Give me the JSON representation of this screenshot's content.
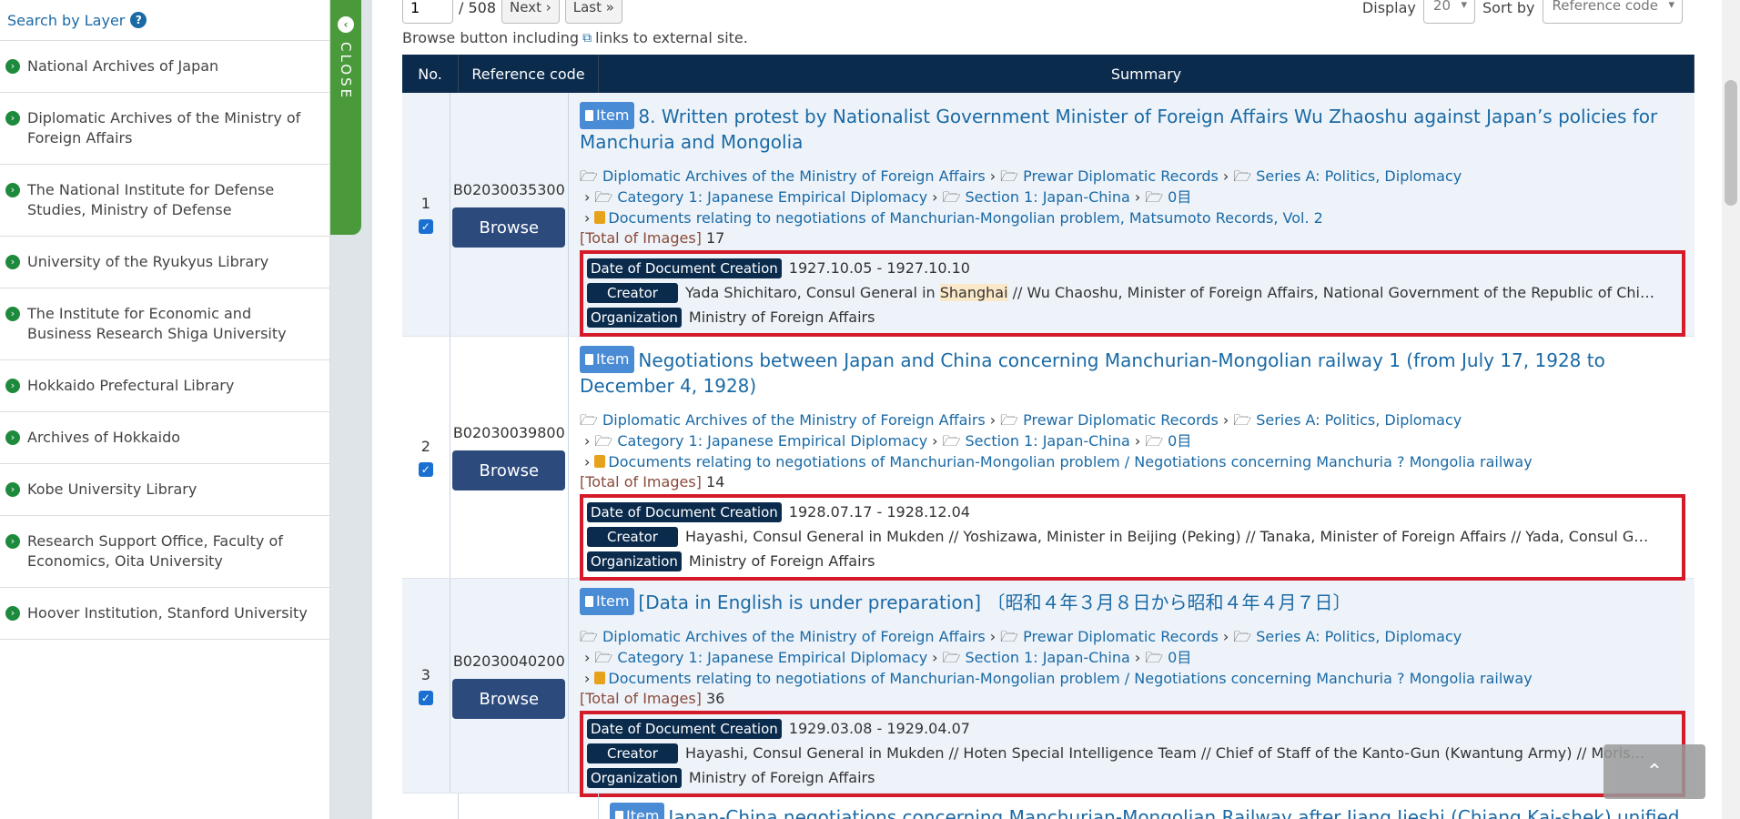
{
  "sidebar": {
    "header": "Search by Layer",
    "help_icon": "?",
    "items": [
      {
        "label": "National Archives of Japan"
      },
      {
        "label": "Diplomatic Archives of the Ministry of Foreign Affairs"
      },
      {
        "label": "The National Institute for Defense Studies, Ministry of Defense"
      },
      {
        "label": "University of the Ryukyus Library"
      },
      {
        "label": "The Institute for Economic and Business Research Shiga University"
      },
      {
        "label": "Hokkaido Prefectural Library"
      },
      {
        "label": "Archives of Hokkaido"
      },
      {
        "label": "Kobe University Library"
      },
      {
        "label": "Research Support Office, Faculty of Economics, Oita University"
      },
      {
        "label": "Hoover Institution, Stanford University"
      }
    ],
    "close_label": "CLOSE"
  },
  "pager": {
    "page_value": "1",
    "total": "/ 508",
    "next_label": "Next ›",
    "last_label": "Last »"
  },
  "display": {
    "display_label": "Display",
    "display_value": "20",
    "sort_label": "Sort by",
    "sort_value": "Reference code"
  },
  "notice": {
    "before": "Browse button including",
    "after": "links to external site."
  },
  "table": {
    "headers": {
      "no": "No.",
      "ref": "Reference code",
      "summary": "Summary"
    },
    "item_badge": "Item",
    "browse_label": "Browse",
    "labels": {
      "date": "Date of Document Creation",
      "creator": "Creator",
      "organization": "Organization",
      "total_images": "[Total of Images]"
    },
    "crumbs_common": {
      "c1": "Diplomatic Archives of the Ministry of Foreign Affairs",
      "c2": "Prewar Diplomatic Records",
      "c3": "Series A: Politics, Diplomacy",
      "c4": "Category 1: Japanese Empirical Diplomacy",
      "c5": "Section 1: Japan-China",
      "c6": "0目"
    },
    "rows": [
      {
        "no": "1",
        "ref": "B02030035300",
        "title": "8. Written protest by Nationalist Government Minister of Foreign Affairs Wu Zhaoshu against Japan’s policies for Manchuria and Mongolia",
        "doc": "Documents relating to negotiations of Manchurian-Mongolian problem, Matsumoto Records, Vol. 2",
        "images": "17",
        "date": "1927.10.05 - 1927.10.10",
        "creator_a": "Yada Shichitaro, Consul General in ",
        "creator_hl": "Shanghai",
        "creator_b": " // Wu Chaoshu, Minister of Foreign Affairs, National Government of the Republic of Chi…",
        "org": "Ministry of Foreign Affairs"
      },
      {
        "no": "2",
        "ref": "B02030039800",
        "title": "Negotiations between Japan and China concerning Manchurian-Mongolian railway 1 (from July 17, 1928 to December 4, 1928)",
        "doc": "Documents relating to negotiations of Manchurian-Mongolian problem / Negotiations concerning Manchuria ? Mongolia railway",
        "images": "14",
        "date": "1928.07.17 - 1928.12.04",
        "creator": "Hayashi, Consul General in Mukden // Yoshizawa, Minister in Beijing (Peking) // Tanaka, Minister of Foreign Affairs // Yada, Consul G…",
        "org": "Ministry of Foreign Affairs"
      },
      {
        "no": "3",
        "ref": "B02030040200",
        "title": "[Data in English is under preparation] 〔昭和４年３月８日から昭和４年４月７日〕",
        "doc": "Documents relating to negotiations of Manchurian-Mongolian problem / Negotiations concerning Manchuria ? Mongolia railway",
        "images": "36",
        "date": "1929.03.08 - 1929.04.07",
        "creator": "Hayashi, Consul General in Mukden // Hoten Special Intelligence Team // Chief of Staff of the Kanto-Gun (Kwantung Army) // Moris…",
        "org": "Ministry of Foreign Affairs"
      },
      {
        "title": "Japan-China negotiations concerning Manchurian-Mongolian Railway after Jiang Jieshi (Chiang Kai-shek) unified"
      }
    ]
  },
  "to_top_icon": "chevron-up-icon"
}
